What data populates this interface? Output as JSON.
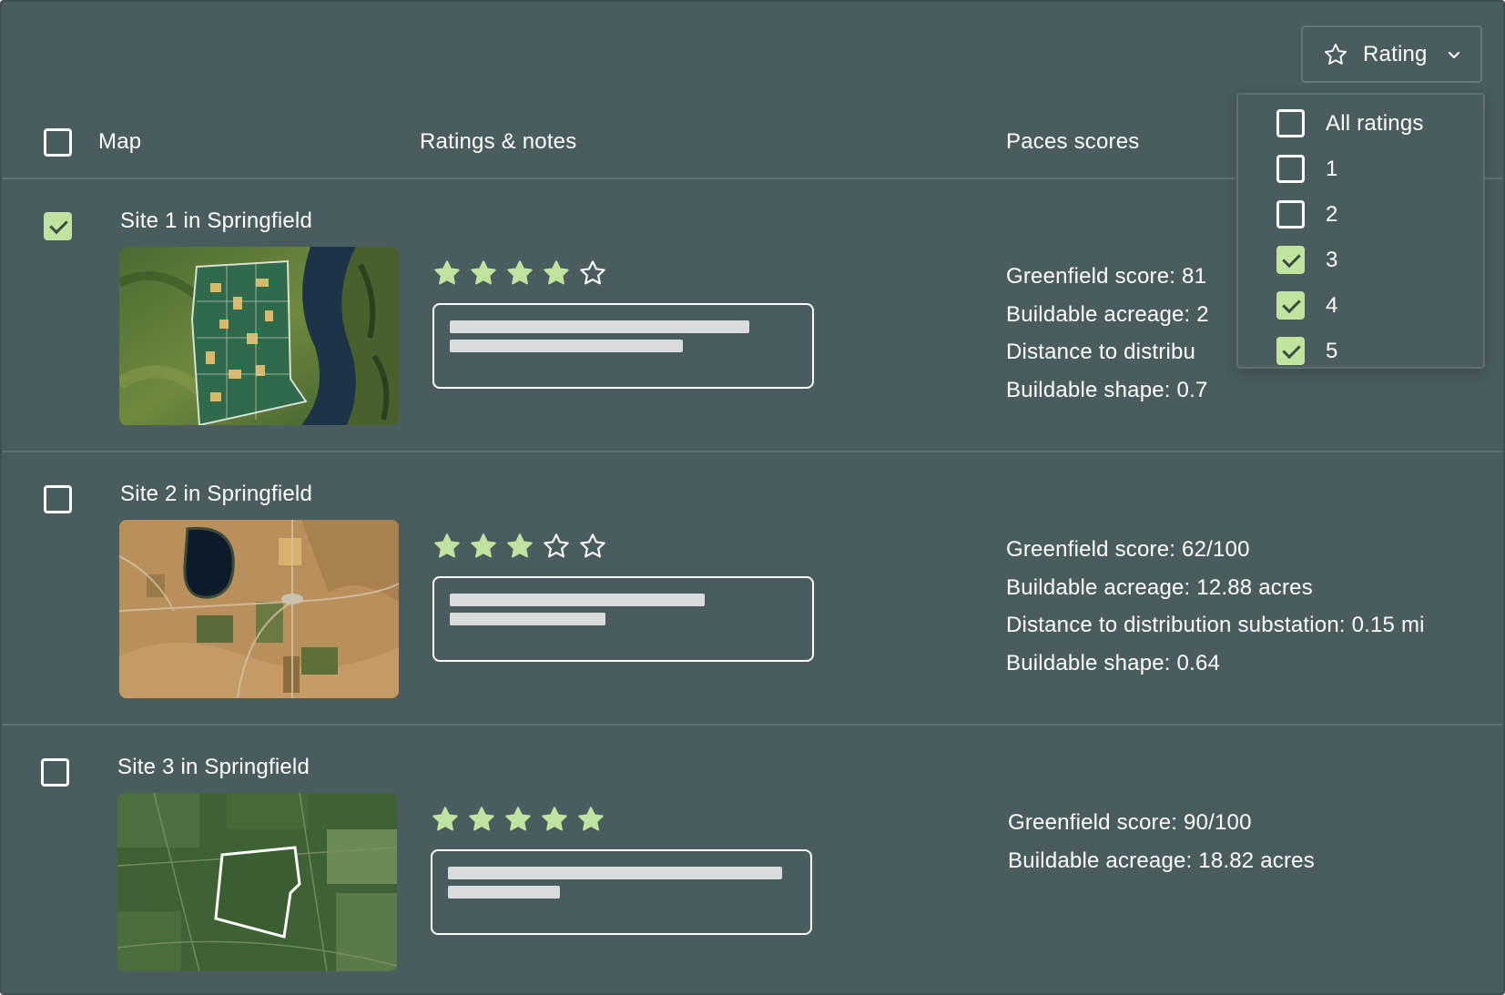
{
  "header": {
    "map_label": "Map",
    "ratings_label": "Ratings & notes",
    "paces_label": "Paces scores"
  },
  "filter": {
    "button_label": "Rating",
    "icon": "star-outline-icon",
    "options": [
      {
        "label": "All ratings",
        "checked": false
      },
      {
        "label": "1",
        "checked": false
      },
      {
        "label": "2",
        "checked": false
      },
      {
        "label": "3",
        "checked": true
      },
      {
        "label": "4",
        "checked": true
      },
      {
        "label": "5",
        "checked": true
      }
    ]
  },
  "sites": [
    {
      "name": "Site 1 in Springfield",
      "selected": true,
      "rating": 4,
      "max_rating": 5,
      "scores": [
        "Greenfield score: 81",
        "Buildable acreage: 2",
        "Distance to distribu",
        "Buildable shape: 0.7"
      ]
    },
    {
      "name": "Site 2 in Springfield",
      "selected": false,
      "rating": 3,
      "max_rating": 5,
      "scores": [
        "Greenfield score: 62/100",
        "Buildable acreage: 12.88 acres",
        "Distance to distribution substation: 0.15 mi",
        "Buildable shape: 0.64"
      ]
    },
    {
      "name": "Site 3 in Springfield",
      "selected": false,
      "rating": 5,
      "max_rating": 5,
      "scores": [
        "Greenfield score: 90/100",
        "Buildable acreage: 18.82 acres"
      ]
    }
  ],
  "colors": {
    "panel_bg": "#4a5c5e",
    "accent_green": "#c1e3a0",
    "text": "#ffffff",
    "placeholder_bar": "#d9dcdd"
  }
}
